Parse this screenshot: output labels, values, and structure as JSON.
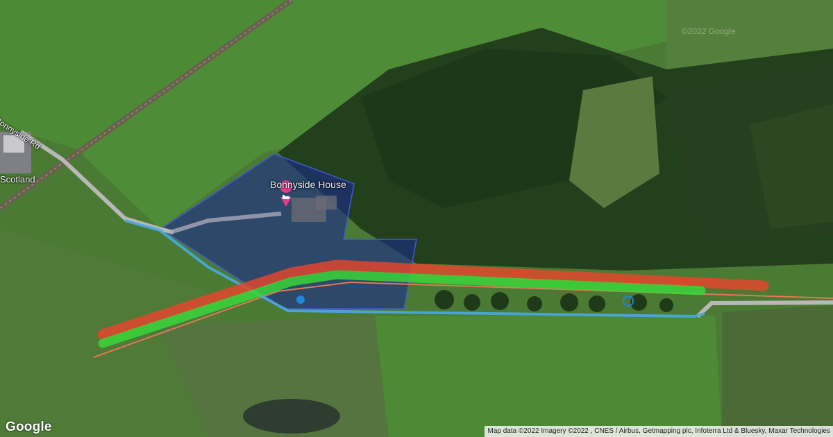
{
  "map": {
    "poi_name": "Bonnyside House",
    "road_label": "Bonnyside Rd",
    "place_label": "Scotland",
    "watermark": "©2022 Google",
    "logo": "Google",
    "attribution": "Map data ©2022 Imagery ©2022 , CNES / Airbus, Getmapping plc, Infoterra Ltd & Bluesky, Maxar Technologies",
    "poi_icon": "hotel-bed-icon",
    "colors": {
      "property_fill": "#1b2a8a",
      "red_route": "#e8442c",
      "green_route": "#3ad63a",
      "blue_path": "#4aa8e0",
      "marker": "#e0408a"
    }
  }
}
